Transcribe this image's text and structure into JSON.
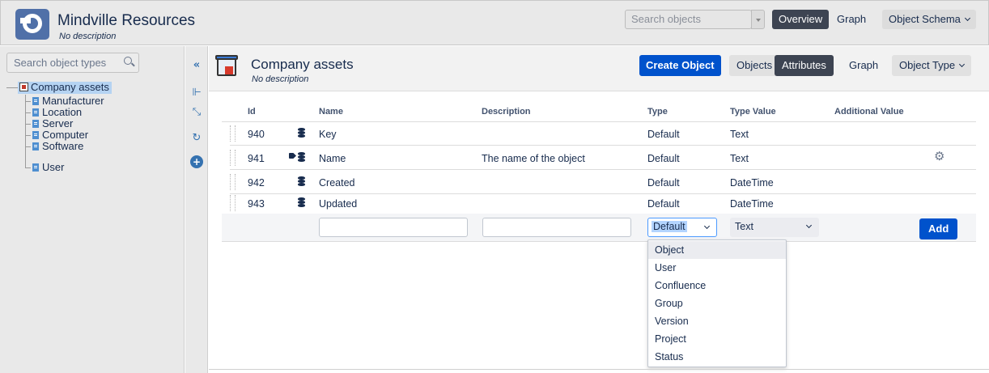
{
  "app": {
    "title": "Mindville Resources",
    "subtitle": "No description"
  },
  "topbar": {
    "search_placeholder": "Search objects",
    "overview_label": "Overview",
    "graph_label": "Graph",
    "schema_label": "Object Schema"
  },
  "sidebar": {
    "search_placeholder": "Search object types",
    "root": "Company assets",
    "children": [
      "Manufacturer",
      "Location",
      "Server",
      "Computer",
      "Software",
      "User"
    ]
  },
  "toolstrip": {
    "icons": [
      "collapse-icon",
      "tree-icon",
      "shrink-icon",
      "refresh-icon",
      "add-icon"
    ]
  },
  "object_type": {
    "title": "Company assets",
    "subtitle": "No description",
    "create_label": "Create Object",
    "tabs": [
      "Objects",
      "Attributes",
      "Graph"
    ],
    "active_tab": "Attributes",
    "type_menu_label": "Object Type"
  },
  "table": {
    "headers": {
      "id": "Id",
      "name": "Name",
      "description": "Description",
      "type": "Type",
      "type_value": "Type Value",
      "additional": "Additional Value"
    },
    "rows": [
      {
        "id": "940",
        "name": "Key",
        "description": "",
        "type": "Default",
        "type_value": "Text",
        "label_tag": false,
        "gear": false
      },
      {
        "id": "941",
        "name": "Name",
        "description": "The name of the object",
        "type": "Default",
        "type_value": "Text",
        "label_tag": true,
        "gear": true
      },
      {
        "id": "942",
        "name": "Created",
        "description": "",
        "type": "Default",
        "type_value": "DateTime",
        "label_tag": false,
        "gear": false
      },
      {
        "id": "943",
        "name": "Updated",
        "description": "",
        "type": "Default",
        "type_value": "DateTime",
        "label_tag": false,
        "gear": false
      }
    ]
  },
  "new_attribute": {
    "type_selected": "Default",
    "type_value_selected": "Text",
    "add_label": "Add"
  },
  "type_dropdown": {
    "options": [
      "Object",
      "User",
      "Confluence",
      "Group",
      "Version",
      "Project",
      "Status"
    ],
    "highlighted": "Object"
  }
}
